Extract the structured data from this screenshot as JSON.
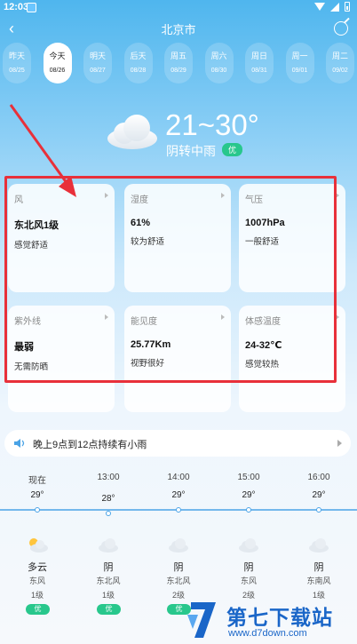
{
  "status": {
    "time": "12:03"
  },
  "header": {
    "city": "北京市"
  },
  "days": [
    {
      "name": "昨天",
      "date": "08/25"
    },
    {
      "name": "今天",
      "date": "08/26",
      "active": true
    },
    {
      "name": "明天",
      "date": "08/27"
    },
    {
      "name": "后天",
      "date": "08/28"
    },
    {
      "name": "周五",
      "date": "08/29"
    },
    {
      "name": "周六",
      "date": "08/30"
    },
    {
      "name": "周日",
      "date": "08/31"
    },
    {
      "name": "周一",
      "date": "09/01"
    },
    {
      "name": "周二",
      "date": "09/02"
    }
  ],
  "current": {
    "temp": "21~30°",
    "condition": "阴转中雨",
    "aqi": "优"
  },
  "details": [
    {
      "label": "风",
      "value": "东北风1级",
      "desc": "感觉舒适"
    },
    {
      "label": "湿度",
      "value": "61%",
      "desc": "较为舒适"
    },
    {
      "label": "气压",
      "value": "1007hPa",
      "desc": "一般舒适"
    },
    {
      "label": "紫外线",
      "value": "最弱",
      "desc": "无需防晒"
    },
    {
      "label": "能见度",
      "value": "25.77Km",
      "desc": "视野很好"
    },
    {
      "label": "体感温度",
      "value": "24-32℃",
      "desc": "感觉较热"
    }
  ],
  "notice": {
    "text": "晚上9点到12点持续有小雨"
  },
  "hourly": [
    {
      "time": "现在",
      "temp": "29°",
      "temp_value": 29,
      "cond": "多云",
      "wind": "东风",
      "level": "1级",
      "aqi": "优",
      "icon": "partly-cloudy-icon"
    },
    {
      "time": "13:00",
      "temp": "28°",
      "temp_value": 28,
      "cond": "阴",
      "wind": "东北风",
      "level": "1级",
      "aqi": "优",
      "icon": "cloud-icon"
    },
    {
      "time": "14:00",
      "temp": "29°",
      "temp_value": 29,
      "cond": "阴",
      "wind": "东北风",
      "level": "2级",
      "aqi": "优",
      "icon": "cloud-icon"
    },
    {
      "time": "15:00",
      "temp": "29°",
      "temp_value": 29,
      "cond": "阴",
      "wind": "东风",
      "level": "2级",
      "aqi": "",
      "icon": "cloud-icon"
    },
    {
      "time": "16:00",
      "temp": "29°",
      "temp_value": 29,
      "cond": "阴",
      "wind": "东南风",
      "level": "1级",
      "aqi": "",
      "icon": "cloud-icon"
    }
  ],
  "watermark": {
    "title": "第七下载站",
    "url": "www.d7down.com"
  },
  "colors": {
    "accent": "#4aa3e6",
    "good": "#28c78c",
    "highlight": "#e8303a",
    "brand": "#1a66c8"
  }
}
